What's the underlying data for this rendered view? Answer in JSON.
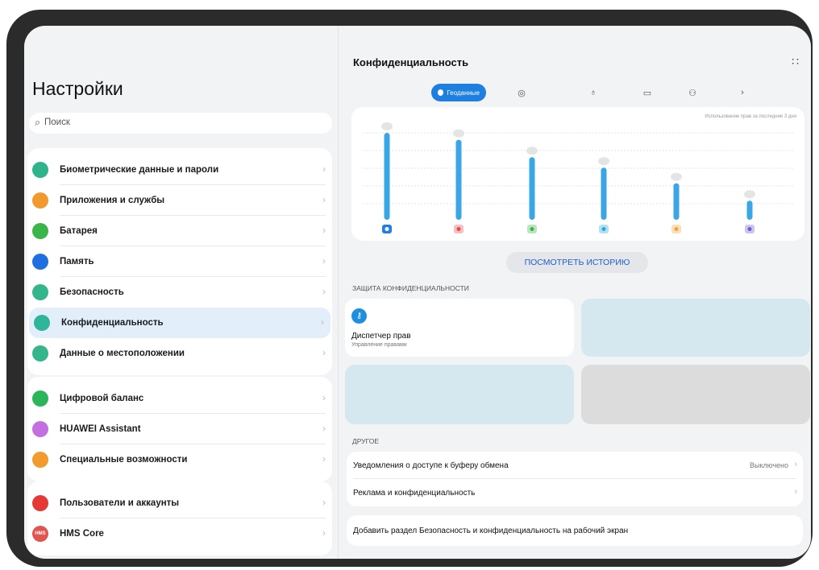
{
  "sidebar": {
    "title": "Настройки",
    "search_placeholder": "Поиск",
    "groups": [
      {
        "items": [
          {
            "label": "Биометрические данные и пароли",
            "icon": "key-icon",
            "color": "#2fb38b"
          },
          {
            "label": "Приложения и службы",
            "icon": "apps-grid-icon",
            "color": "#f2992e"
          },
          {
            "label": "Батарея",
            "icon": "battery-icon",
            "color": "#3ab54a"
          },
          {
            "label": "Память",
            "icon": "storage-icon",
            "color": "#1f6fe0"
          },
          {
            "label": "Безопасность",
            "icon": "shield-icon",
            "color": "#34b58c"
          },
          {
            "label": "Конфиденциальность",
            "icon": "privacy-icon",
            "color": "#2fb59a",
            "selected": true
          },
          {
            "label": "Данные о местоположении",
            "icon": "location-pin-icon",
            "color": "#34b58c"
          }
        ]
      },
      {
        "items": [
          {
            "label": "Цифровой баланс",
            "icon": "hourglass-icon",
            "color": "#2cb55a"
          },
          {
            "label": "HUAWEI Assistant",
            "icon": "assistant-icon",
            "color": "#c36fe0"
          },
          {
            "label": "Специальные возможности",
            "icon": "accessibility-icon",
            "color": "#f29a2e"
          }
        ]
      },
      {
        "items": [
          {
            "label": "Пользователи и аккаунты",
            "icon": "user-icon",
            "color": "#e53935"
          },
          {
            "label": "HMS Core",
            "icon": "hms-core-icon",
            "color": "#e0554f",
            "badge": "HMS"
          }
        ]
      }
    ]
  },
  "main": {
    "title": "Конфиденциальность",
    "tabs": [
      {
        "label": "Геоданные",
        "icon": "location-pin-icon",
        "active": true
      },
      {
        "icon": "camera-icon"
      },
      {
        "icon": "microphone-icon"
      },
      {
        "icon": "folder-icon"
      },
      {
        "icon": "contacts-icon"
      },
      {
        "icon": "chevron-right-icon"
      }
    ],
    "chart_caption": "Использование прав за последние 3 дня",
    "history_button": "ПОСМОТРЕТЬ ИСТОРИЮ",
    "protection_section": "ЗАЩИТА КОНФИДЕНЦИАЛЬНОСТИ",
    "permission_tile": {
      "title": "Диспетчер прав",
      "subtitle": "Управление правами"
    },
    "other_section": "ДРУГОЕ",
    "other_rows": [
      {
        "label": "Уведомления о доступе к буферу обмена",
        "value": "Выключено"
      },
      {
        "label": "Реклама и конфиденциальность",
        "value": ""
      }
    ],
    "add_row": "Добавить раздел Безопасность и конфиденциальность на рабочий экран"
  },
  "chart_data": {
    "type": "bar",
    "categories": [
      "app-1",
      "app-2",
      "app-3",
      "app-4",
      "app-5",
      "app-6"
    ],
    "app_icon_colors": [
      "#1e7fe1",
      "#e84a4a",
      "#3bb54a",
      "#2ba7e0",
      "#f2a33a",
      "#6d5bd0"
    ],
    "values": [
      100,
      92,
      72,
      60,
      42,
      22
    ],
    "ylim": [
      0,
      100
    ],
    "grid": true,
    "bar_color": "#3aa6e6"
  }
}
